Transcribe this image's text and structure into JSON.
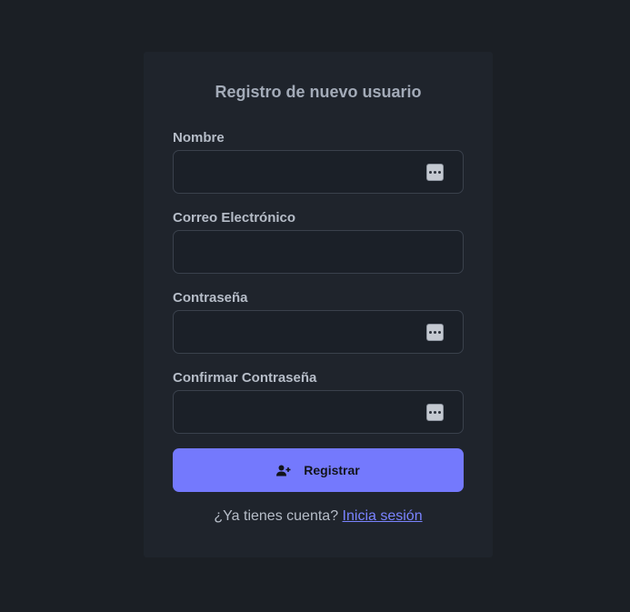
{
  "form": {
    "title": "Registro de nuevo usuario",
    "fields": [
      {
        "label": "Nombre",
        "value": "",
        "placeholder": "",
        "has_menu_icon": true
      },
      {
        "label": "Correo Electrónico",
        "value": "",
        "placeholder": "",
        "has_menu_icon": false
      },
      {
        "label": "Contraseña",
        "value": "",
        "placeholder": "",
        "has_menu_icon": true
      },
      {
        "label": "Confirmar Contraseña",
        "value": "",
        "placeholder": "",
        "has_menu_icon": true
      }
    ],
    "submit_label": "Registrar",
    "submit_icon": "user-plus-icon"
  },
  "footer": {
    "prompt": "¿Ya tienes cuenta?",
    "link_label": "Inicia sesión"
  },
  "colors": {
    "background": "#1b1f25",
    "card": "#1f242c",
    "accent": "#7479fd",
    "link": "#7a83ff"
  }
}
